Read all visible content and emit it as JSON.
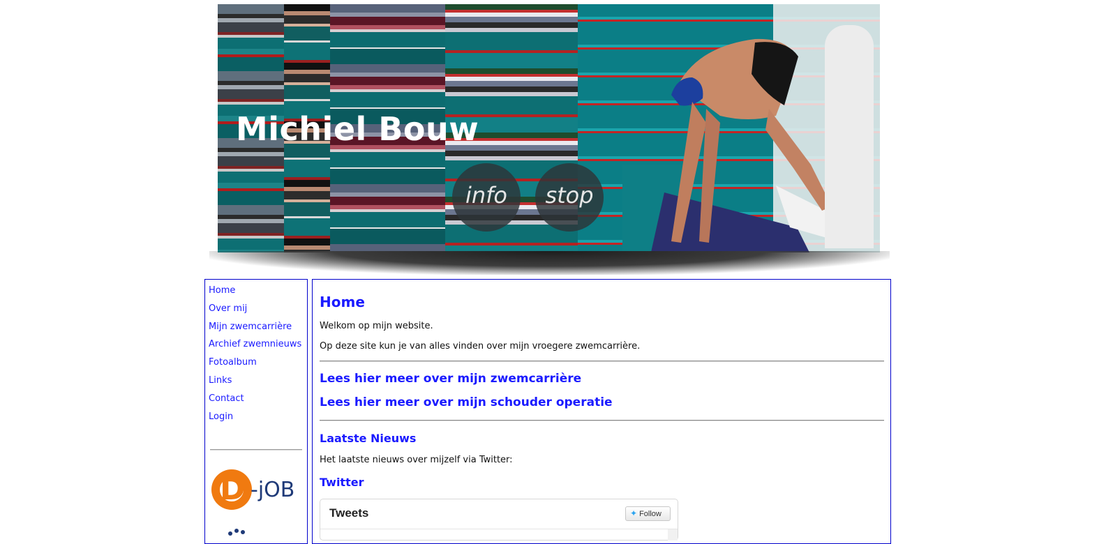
{
  "header": {
    "site_title": "Michiel Bouw",
    "buttons": {
      "info": "info",
      "stop": "stop"
    }
  },
  "sidebar": {
    "items": [
      {
        "label": "Home"
      },
      {
        "label": "Over mij"
      },
      {
        "label": "Mijn zwemcarrière"
      },
      {
        "label": "Archief zwemnieuws"
      },
      {
        "label": "Fotoalbum"
      },
      {
        "label": "Links"
      },
      {
        "label": "Contact"
      },
      {
        "label": "Login"
      }
    ],
    "sponsor_logo": {
      "letter": "D",
      "text": "-jOB"
    }
  },
  "main": {
    "title": "Home",
    "intro": [
      "Welkom op mijn website.",
      "Op deze site kun je van alles vinden over mijn vroegere zwemcarrière."
    ],
    "links": [
      "Lees hier meer over mijn zwemcarrière",
      "Lees hier meer over mijn schouder operatie"
    ],
    "news": {
      "heading": "Laatste Nieuws",
      "text": "Het laatste nieuws over mijzelf via Twitter:"
    },
    "twitter": {
      "heading": "Twitter",
      "widget_title": "Tweets",
      "follow_label": "Follow"
    }
  },
  "colors": {
    "link": "#1a1aff",
    "border": "#0000cc",
    "orange": "#f07a10",
    "navy": "#1f3a78"
  }
}
